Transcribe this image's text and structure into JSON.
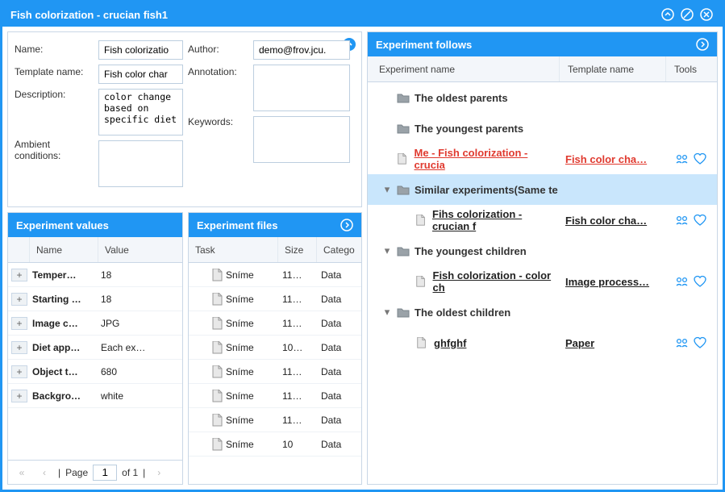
{
  "window": {
    "title": "Fish colorization - crucian fish1"
  },
  "form": {
    "name_label": "Name:",
    "name_value": "Fish colorizatio",
    "template_label": "Template name:",
    "template_value": "Fish color char",
    "description_label": "Description:",
    "description_value": "color change based on specific diet",
    "ambient_label": "Ambient conditions:",
    "ambient_value": "",
    "author_label": "Author:",
    "author_value": "demo@frov.jcu.",
    "annotation_label": "Annotation:",
    "annotation_value": "",
    "keywords_label": "Keywords:",
    "keywords_value": ""
  },
  "values": {
    "title": "Experiment values",
    "col_name": "Name",
    "col_value": "Value",
    "rows": [
      {
        "name": "Temper…",
        "value": "18"
      },
      {
        "name": "Starting …",
        "value": "18"
      },
      {
        "name": "Image c…",
        "value": "JPG"
      },
      {
        "name": "Diet app…",
        "value": "Each ex…"
      },
      {
        "name": "Object t…",
        "value": "680"
      },
      {
        "name": "Backgro…",
        "value": "white"
      }
    ],
    "pager": {
      "page_label": "Page",
      "page_value": "1",
      "of_label": "of 1"
    }
  },
  "files": {
    "title": "Experiment files",
    "col_task": "Task",
    "col_size": "Size",
    "col_category": "Catego",
    "rows": [
      {
        "task": "Sníme",
        "size": "11…",
        "category": "Data"
      },
      {
        "task": "Sníme",
        "size": "11…",
        "category": "Data"
      },
      {
        "task": "Sníme",
        "size": "11…",
        "category": "Data"
      },
      {
        "task": "Sníme",
        "size": "10…",
        "category": "Data"
      },
      {
        "task": "Sníme",
        "size": "11…",
        "category": "Data"
      },
      {
        "task": "Sníme",
        "size": "11…",
        "category": "Data"
      },
      {
        "task": "Sníme",
        "size": "11…",
        "category": "Data"
      },
      {
        "task": "Sníme",
        "size": "10",
        "category": "Data"
      }
    ]
  },
  "follows": {
    "title": "Experiment follows",
    "col_name": "Experiment name",
    "col_template": "Template name",
    "col_tools": "Tools",
    "nodes": [
      {
        "kind": "folder",
        "level": 1,
        "label": "The oldest parents",
        "twisty": "blank"
      },
      {
        "kind": "folder",
        "level": 1,
        "label": "The youngest parents",
        "twisty": "blank"
      },
      {
        "kind": "doc",
        "level": 1,
        "label": "Me - Fish colorization - crucia",
        "template": "Fish color cha…",
        "tools": true,
        "red": true
      },
      {
        "kind": "folder",
        "level": 1,
        "label": "Similar experiments(Same te",
        "twisty": "down",
        "selected": true
      },
      {
        "kind": "doc",
        "level": 2,
        "label": "Fihs colorization - crucian f",
        "template": "Fish color cha…",
        "tools": true
      },
      {
        "kind": "folder",
        "level": 1,
        "label": "The youngest children",
        "twisty": "down"
      },
      {
        "kind": "doc",
        "level": 2,
        "label": "Fish colorization - color ch",
        "template": "Image process…",
        "tools": true
      },
      {
        "kind": "folder",
        "level": 1,
        "label": "The oldest children",
        "twisty": "down"
      },
      {
        "kind": "doc",
        "level": 2,
        "label": "ghfghf",
        "template": "Paper",
        "tools": true
      }
    ]
  }
}
